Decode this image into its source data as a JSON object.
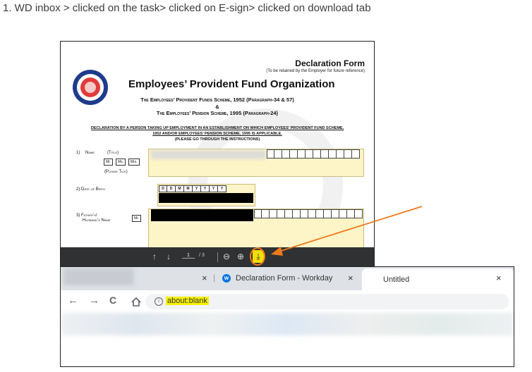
{
  "step_text": "1. WD inbox > clicked on the task> clicked on E-sign> clicked on download tab",
  "pdf": {
    "doc_title": "Declaration Form",
    "doc_subtitle": "(To be retained by the Employer for future reference)",
    "org_name": "Employees’ Provident Fund Organization",
    "scheme1": "The Employees’ Provident Funds Scheme, 1952 (Paragraph-34 & 57)",
    "amp": "&",
    "scheme2": "The Employees’ Pension Scheme, 1995 (Paragraph-24)",
    "declaration1": "DECLARATION BY A PERSON TAKING UP EMPLOYMENT IN AN ESTABLISHMENT ON WHICH EMPLOYEES’ PROVIDENT FUND SCHEME,",
    "declaration2": "1952 AND/OR EMPLOYEES’ PENSION SCHEME, 1995 IS APPLICABLE.",
    "declaration3": "(PLEASE GO THROUGH THE INSTRUCTIONS)",
    "field1_num": "1)",
    "field1_label": "Name",
    "field1_title": "(Title)",
    "title_mr": "Mr.",
    "title_ms": "Ms.",
    "title_mrs": "Mrs.",
    "please_tick": "(Please Tick)",
    "field2_label": "2)  Date of Birth",
    "dob_cells": [
      "D",
      "D",
      "M",
      "M",
      "Y",
      "Y",
      "Y",
      "Y"
    ],
    "field3_label_a": "3)  Father's/",
    "field3_label_b": "Husband's Name",
    "field3_title": "Mr.",
    "toolbar": {
      "up": "↑",
      "down": "↓",
      "page_current": "1",
      "page_total": "/ 3",
      "zoom_out": "⊖",
      "zoom_in": "⊕",
      "download": "⤓"
    }
  },
  "browser": {
    "tab_close": "×",
    "tab2_title": "Declaration Form - Workday",
    "tab3_title": "Untitled",
    "back": "←",
    "forward": "→",
    "reload": "C",
    "info": "i",
    "url": "about:blank"
  },
  "colors": {
    "highlight": "#f4df00",
    "annotation_arrow": "#f07a1a",
    "workday_blue": "#0875e1"
  }
}
